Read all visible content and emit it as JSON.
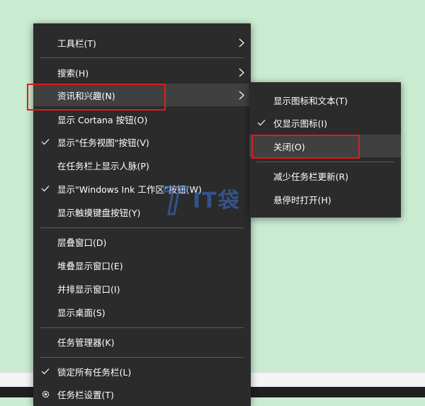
{
  "main_menu": {
    "toolbar": "工具栏(T)",
    "search": "搜索(H)",
    "news_interests": "资讯和兴趣(N)",
    "show_cortana": "显示 Cortana 按钮(O)",
    "show_task_view": "显示\"任务视图\"按钮(V)",
    "show_people": "在任务栏上显示人脉(P)",
    "show_ink": "显示\"Windows Ink 工作区\"按钮(W)",
    "show_touch_keyboard": "显示触摸键盘按钮(Y)",
    "cascade": "层叠窗口(D)",
    "stack": "堆叠显示窗口(E)",
    "side_by_side": "并排显示窗口(I)",
    "show_desktop": "显示桌面(S)",
    "task_manager": "任务管理器(K)",
    "lock_taskbars": "锁定所有任务栏(L)",
    "taskbar_settings": "任务栏设置(T)"
  },
  "sub_menu": {
    "show_icon_text": "显示图标和文本(T)",
    "show_icon_only": "仅显示图标(I)",
    "turn_off": "关闭(O)",
    "reduce_updates": "减少任务栏更新(R)",
    "open_on_hover": "悬停时打开(H)"
  },
  "watermark": {
    "brand": "IT袋"
  },
  "colors": {
    "menu_bg": "#2b2b2b",
    "hover_bg": "#404040",
    "highlight_red": "#e01b1b",
    "desktop_bg": "#c9ecd0"
  }
}
